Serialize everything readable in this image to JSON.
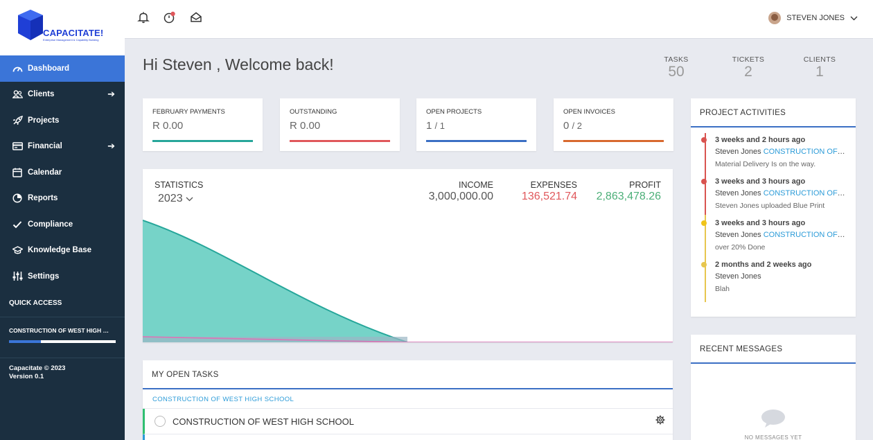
{
  "brand": {
    "name": "CAPACITATE!",
    "tagline": "Enterprise Management & Capability Building",
    "color": "#1f3fd6"
  },
  "sidebar": {
    "items": [
      {
        "label": "Dashboard",
        "icon": "gauge-icon",
        "active": true
      },
      {
        "label": "Clients",
        "icon": "users-icon",
        "arrow": true
      },
      {
        "label": "Projects",
        "icon": "rocket-icon"
      },
      {
        "label": "Financial",
        "icon": "credit-card-icon",
        "arrow": true
      },
      {
        "label": "Calendar",
        "icon": "calendar-icon"
      },
      {
        "label": "Reports",
        "icon": "reports-icon"
      },
      {
        "label": "Compliance",
        "icon": "check-icon"
      },
      {
        "label": "Knowledge Base",
        "icon": "graduation-cap-icon"
      },
      {
        "label": "Settings",
        "icon": "sliders-icon"
      }
    ],
    "quick_access_title": "QUICK ACCESS",
    "quick_item": {
      "label": "CONSTRUCTION OF WEST HIGH …",
      "progress": 0.3
    },
    "footer_line1": "Capacitate © 2023",
    "footer_line2": "Version 0.1"
  },
  "header": {
    "icons": [
      "bell-icon",
      "timer-icon",
      "mail-icon"
    ],
    "user_name": "STEVEN JONES"
  },
  "welcome": "Hi Steven , Welcome back!",
  "stats": [
    {
      "label": "TASKS",
      "value": "50"
    },
    {
      "label": "TICKETS",
      "value": "2"
    },
    {
      "label": "CLIENTS",
      "value": "1"
    }
  ],
  "summary_cards": [
    {
      "label": "FEBRUARY PAYMENTS",
      "value": "R 0.00",
      "suffix": "",
      "color": "#26a69a"
    },
    {
      "label": "OUTSTANDING",
      "value": "R 0.00",
      "suffix": "",
      "color": "#e0575b"
    },
    {
      "label": "OPEN PROJECTS",
      "value": "1",
      "suffix": "/ 1",
      "color": "#3b6fc4"
    },
    {
      "label": "OPEN INVOICES",
      "value": "0",
      "suffix": "/ 2",
      "color": "#d8692f"
    }
  ],
  "statistics": {
    "title": "STATISTICS",
    "year": "2023",
    "income_label": "INCOME",
    "income": "3,000,000.00",
    "expenses_label": "EXPENSES",
    "expenses": "136,521.74",
    "profit_label": "PROFIT",
    "profit": "2,863,478.26",
    "colors": {
      "income": "#555555",
      "expenses": "#e0575b",
      "profit": "#4caf78",
      "area": "#76d3c8",
      "line": "#26a69a"
    }
  },
  "tasks": {
    "title": "MY OPEN TASKS",
    "group": "CONSTRUCTION OF WEST HIGH SCHOOL",
    "items": [
      {
        "title": "CONSTRUCTION OF WEST HIGH SCHOOL"
      }
    ]
  },
  "activities": {
    "title": "PROJECT ACTIVITIES",
    "items": [
      {
        "time": "3 weeks and 2 hours ago",
        "user": "Steven Jones",
        "project": "CONSTRUCTION OF WEST HIGH SCHOOL",
        "message": "Material Delivery Is on the way.",
        "color": "#d9534f"
      },
      {
        "time": "3 weeks and 3 hours ago",
        "user": "Steven Jones",
        "project": "CONSTRUCTION OF WEST HIGH SCHOOL",
        "message": "Steven Jones uploaded Blue Print",
        "color": "#d9534f"
      },
      {
        "time": "3 weeks and 3 hours ago",
        "user": "Steven Jones",
        "project": "CONSTRUCTION OF WEST HIGH SCHOOL",
        "message": "over 20% Done",
        "color": "#f0c419"
      },
      {
        "time": "2 months and 2 weeks ago",
        "user": "Steven Jones",
        "project": "",
        "message": "Blah",
        "color": "#e7c64e"
      }
    ]
  },
  "messages": {
    "title": "RECENT MESSAGES",
    "empty": "NO MESSAGES YET"
  }
}
